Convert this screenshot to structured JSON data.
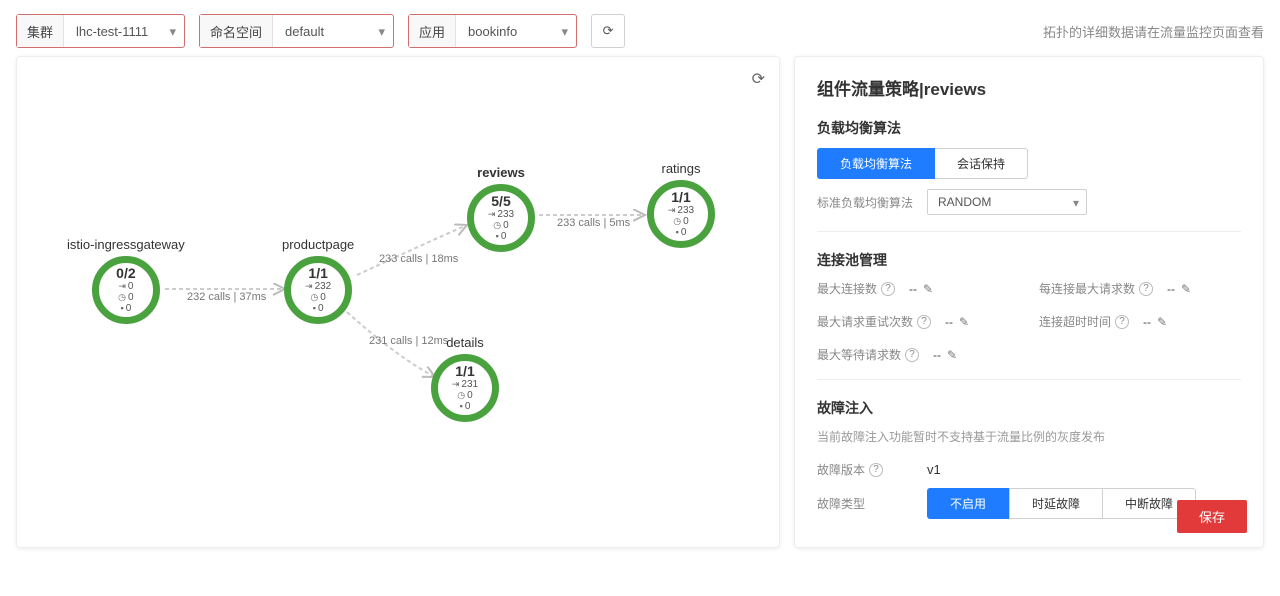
{
  "topbar": {
    "cluster_label": "集群",
    "cluster_value": "lhc-test-1111",
    "namespace_label": "命名空间",
    "namespace_value": "default",
    "app_label": "应用",
    "app_value": "bookinfo",
    "hint": "拓扑的详细数据请在流量监控页面查看"
  },
  "topology": {
    "nodes": {
      "ingress": {
        "name": "istio-ingressgateway",
        "ratio": "0/2",
        "in": "0",
        "clock": "0",
        "pod": "0"
      },
      "productpage": {
        "name": "productpage",
        "ratio": "1/1",
        "in": "232",
        "clock": "0",
        "pod": "0"
      },
      "reviews": {
        "name": "reviews",
        "ratio": "5/5",
        "in": "233",
        "clock": "0",
        "pod": "0"
      },
      "ratings": {
        "name": "ratings",
        "ratio": "1/1",
        "in": "233",
        "clock": "0",
        "pod": "0"
      },
      "details": {
        "name": "details",
        "ratio": "1/1",
        "in": "231",
        "clock": "0",
        "pod": "0"
      }
    },
    "edges": {
      "e1": "232 calls | 37ms",
      "e2": "233 calls | 18ms",
      "e3": "233 calls | 5ms",
      "e4": "231 calls | 12ms"
    }
  },
  "panel": {
    "title": "组件流量策略|reviews",
    "lb": {
      "heading": "负载均衡算法",
      "tab_lb": "负载均衡算法",
      "tab_session": "会话保持",
      "std_label": "标准负载均衡算法",
      "std_value": "RANDOM"
    },
    "pool": {
      "heading": "连接池管理",
      "max_conn": "最大连接数",
      "per_conn_req": "每连接最大请求数",
      "max_retry": "最大请求重试次数",
      "conn_timeout": "连接超时时间",
      "max_pending": "最大等待请求数",
      "empty": "--"
    },
    "fault": {
      "heading": "故障注入",
      "note": "当前故障注入功能暂时不支持基于流量比例的灰度发布",
      "version_label": "故障版本",
      "version_value": "v1",
      "type_label": "故障类型",
      "type_none": "不启用",
      "type_delay": "时延故障",
      "type_abort": "中断故障"
    },
    "save": "保存"
  }
}
